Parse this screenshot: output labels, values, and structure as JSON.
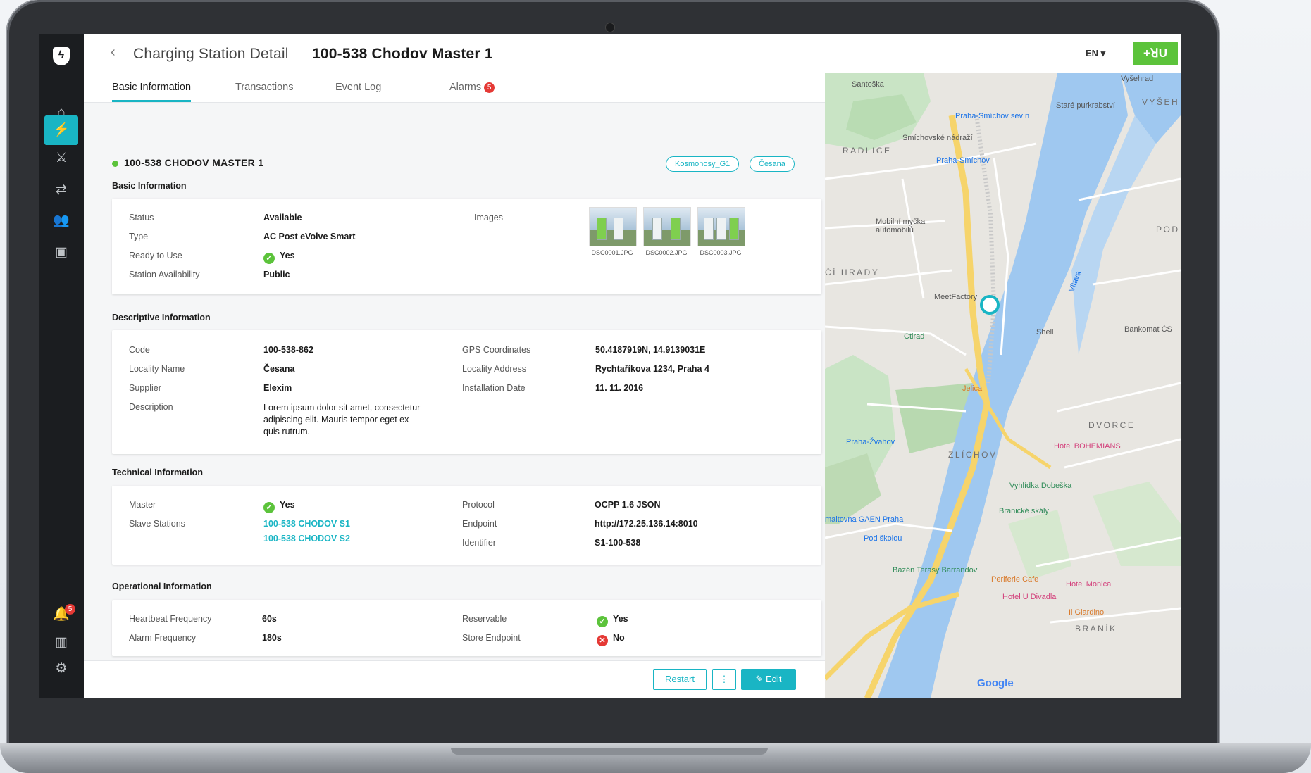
{
  "header": {
    "back": "‹",
    "title_prefix": "Charging Station Detail",
    "title_main": "100-538 Chodov Master 1",
    "language": "EN ▾",
    "brand_button": "+ꓤU"
  },
  "sidebar": {
    "badge_count": "5"
  },
  "tabs": [
    {
      "label": "Basic Information"
    },
    {
      "label": "Transactions"
    },
    {
      "label": "Event Log"
    },
    {
      "label": "Alarms",
      "badge": "5"
    }
  ],
  "station": {
    "name": "100-538 CHODOV MASTER 1",
    "tags": [
      "Kosmonosy_G1",
      "Česana"
    ]
  },
  "basic": {
    "title": "Basic Information",
    "status_label": "Status",
    "status_value": "Available",
    "type_label": "Type",
    "type_value": "AC Post eVolve Smart",
    "ready_label": "Ready to Use",
    "ready_value": "Yes",
    "availability_label": "Station Availability",
    "availability_value": "Public",
    "images_label": "Images",
    "images": [
      "DSC0001.JPG",
      "DSC0002.JPG",
      "DSC0003.JPG"
    ]
  },
  "descriptive": {
    "title": "Descriptive Information",
    "code_label": "Code",
    "code_value": "100-538-862",
    "locality_name_label": "Locality Name",
    "locality_name_value": "Česana",
    "supplier_label": "Supplier",
    "supplier_value": "Elexim",
    "description_label": "Description",
    "description_value": "Lorem ipsum dolor sit amet, consectetur adipiscing elit. Mauris tempor eget ex quis rutrum.",
    "gps_label": "GPS Coordinates",
    "gps_value": "50.4187919N, 14.9139031E",
    "address_label": "Locality Address",
    "address_value": "Rychtaříkova 1234, Praha 4",
    "install_label": "Installation Date",
    "install_value": "11. 11. 2016"
  },
  "technical": {
    "title": "Technical Information",
    "master_label": "Master",
    "master_value": "Yes",
    "slave_label": "Slave Stations",
    "slaves": [
      "100-538 CHODOV S1",
      "100-538 CHODOV S2"
    ],
    "protocol_label": "Protocol",
    "protocol_value": "OCPP 1.6 JSON",
    "endpoint_label": "Endpoint",
    "endpoint_value": "http://172.25.136.14:8010",
    "identifier_label": "Identifier",
    "identifier_value": "S1-100-538"
  },
  "operational": {
    "title": "Operational Information",
    "heartbeat_label": "Heartbeat Frequency",
    "heartbeat_value": "60s",
    "alarm_label": "Alarm Frequency",
    "alarm_value": "180s",
    "reservable_label": "Reservable",
    "reservable_value": "Yes",
    "store_label": "Store Endpoint",
    "store_value": "No"
  },
  "footer": {
    "restart": "Restart",
    "more": "⋮",
    "edit": "✎  Edit"
  },
  "map": {
    "labels": {
      "santoska": "Santoška",
      "vysehrad": "Vyšehrad",
      "vyseh": "VYŠEH",
      "smichov_sever": "Praha-Smíchov sev n",
      "stare": "Staré purkrabství",
      "smich_nadrazi": "Smíchovské nádraží",
      "radlice": "RADLICE",
      "praha_smichov": "Praha-Smíchov",
      "mycka": "Mobilní myčka automobilů",
      "hrady": "ČÍ HRADY",
      "meetfactory": "MeetFactory",
      "ctirad": "Ctirad",
      "shell": "Shell",
      "bankomat": "Bankomat ČS",
      "jelica": "Jelica",
      "dvorce": "DVORCE",
      "bohemians": "Hotel BOHEMIANS",
      "zlichov": "ZLÍCHOV",
      "zvahov": "Praha-Žvahov",
      "vyhlidka": "Vyhlídka Dobeška",
      "branicke": "Branické skály",
      "gaen": "maltovna GAEN Praha",
      "pod_skolou": "Pod školou",
      "barrandov": "Bazén Terasy Barrandov",
      "periferie": "Periferie Cafe",
      "monica": "Hotel Monica",
      "u_divadla": "Hotel U Divadla",
      "giardino": "Il Giardino",
      "branik": "BRANÍK",
      "google": "Google",
      "pod": "POD",
      "vltava": "Vltava"
    }
  }
}
